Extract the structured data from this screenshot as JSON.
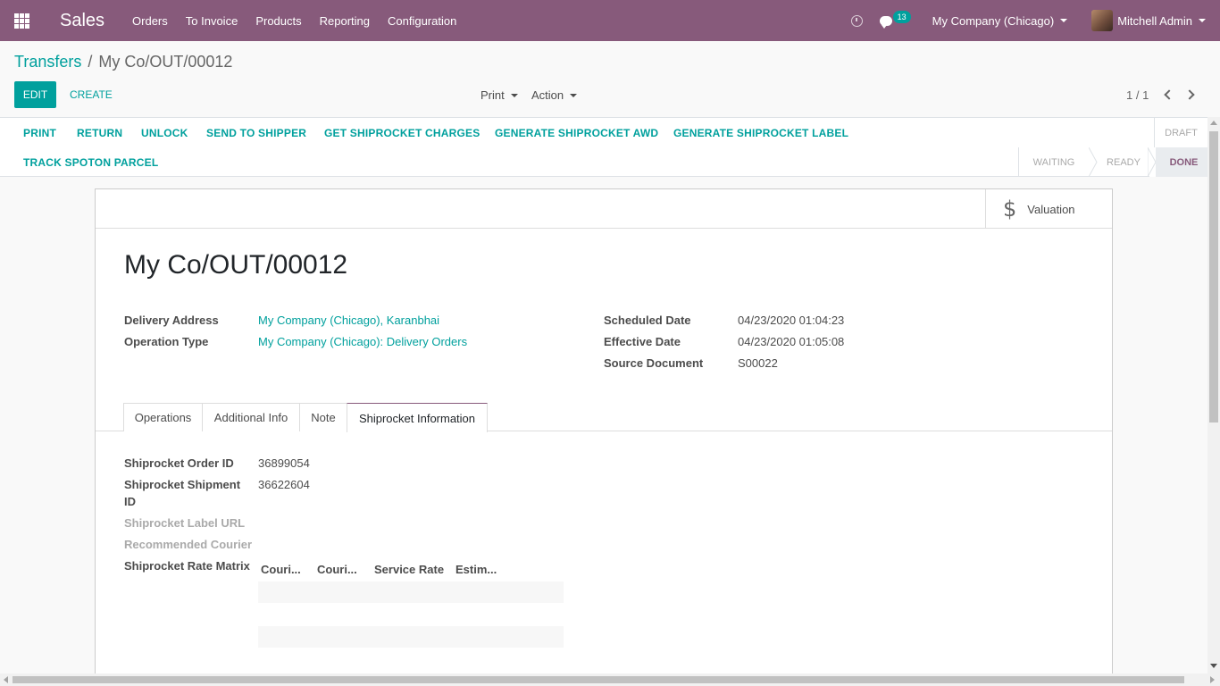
{
  "navbar": {
    "brand": "Sales",
    "menu": [
      "Orders",
      "To Invoice",
      "Products",
      "Reporting",
      "Configuration"
    ],
    "messages_count": "13",
    "company": "My Company (Chicago)",
    "user": "Mitchell Admin"
  },
  "breadcrumb": {
    "parent": "Transfers",
    "separator": "/",
    "current": "My Co/OUT/00012"
  },
  "control": {
    "edit_label": "EDIT",
    "create_label": "CREATE",
    "print_label": "Print",
    "action_label": "Action",
    "pager": "1 / 1"
  },
  "status_buttons": [
    "PRINT",
    "RETURN",
    "UNLOCK",
    "SEND TO SHIPPER",
    "GET SHIPROCKET CHARGES",
    "GENERATE SHIPROCKET AWD",
    "GENERATE SHIPROCKET LABEL",
    "TRACK SPOTON PARCEL"
  ],
  "stages": {
    "draft": "DRAFT",
    "waiting": "WAITING",
    "ready": "READY",
    "done": "DONE"
  },
  "sheet": {
    "valuation_label": "Valuation",
    "title": "My Co/OUT/00012",
    "left_fields": [
      {
        "label": "Delivery Address",
        "value": "My Company (Chicago), Karanbhai"
      },
      {
        "label": "Operation Type",
        "value": "My Company (Chicago): Delivery Orders"
      }
    ],
    "right_fields": [
      {
        "label": "Scheduled Date",
        "value": "04/23/2020 01:04:23"
      },
      {
        "label": "Effective Date",
        "value": "04/23/2020 01:05:08"
      },
      {
        "label": "Source Document",
        "value": "S00022"
      }
    ],
    "tabs": [
      "Operations",
      "Additional Info",
      "Note",
      "Shiprocket Information"
    ],
    "shiprocket": {
      "order_id_label": "Shiprocket Order ID",
      "order_id": "36899054",
      "shipment_id_label_1": "Shiprocket Shipment",
      "shipment_id_label_2": "ID",
      "shipment_id": "36622604",
      "label_url_label": "Shiprocket Label URL",
      "courier_label": "Recommended Courier",
      "rate_matrix_label": "Shiprocket Rate Matrix",
      "matrix_headers": [
        "Couri...",
        "Couri...",
        "Service Rate",
        "Estim..."
      ]
    }
  }
}
